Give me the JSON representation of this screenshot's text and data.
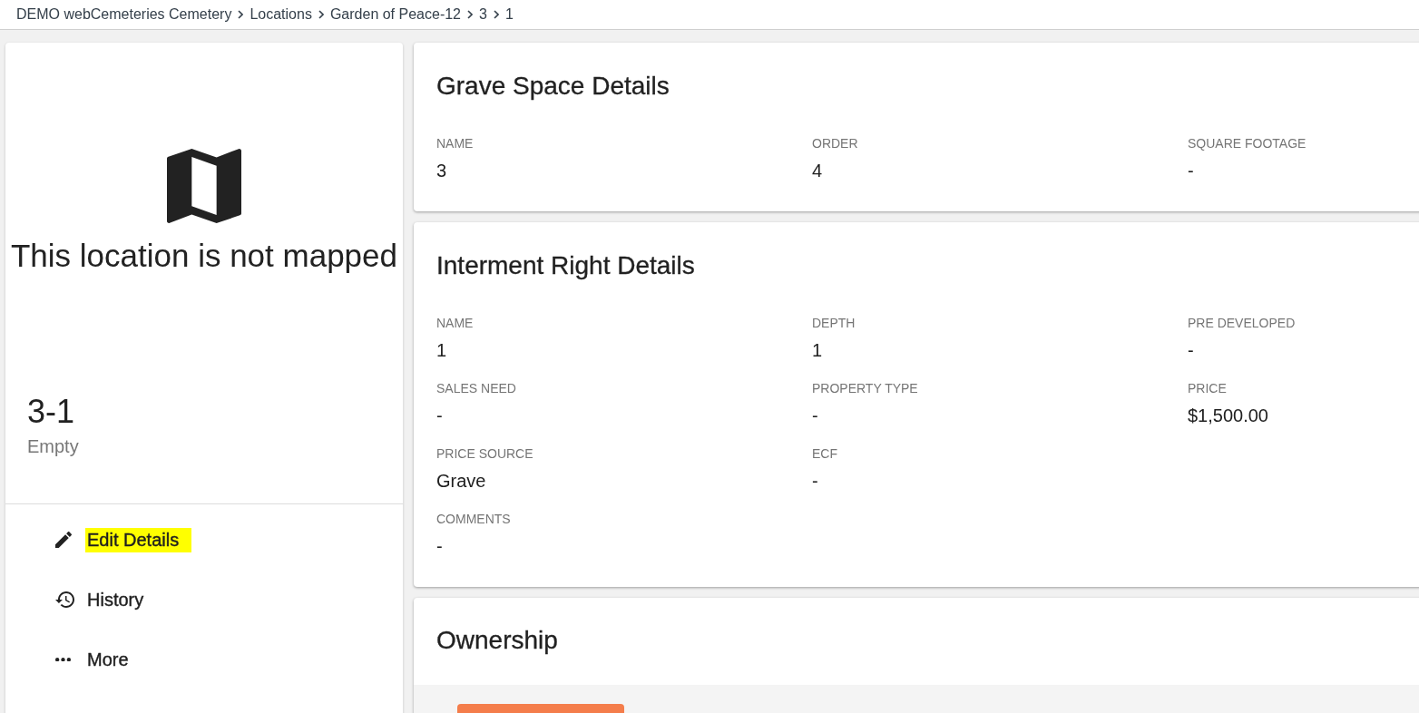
{
  "breadcrumb": {
    "items": [
      "DEMO webCemeteries Cemetery",
      "Locations",
      "Garden of Peace-12",
      "3",
      "1"
    ]
  },
  "left_panel": {
    "map_placeholder": {
      "message": "This location is not mapped"
    },
    "location": {
      "name": "3-1",
      "status": "Empty"
    },
    "actions": [
      {
        "kind": "edit",
        "label": "Edit Details",
        "highlighted": true
      },
      {
        "kind": "history",
        "label": "History",
        "highlighted": false
      },
      {
        "kind": "more",
        "label": "More",
        "highlighted": false
      }
    ]
  },
  "detail_cards": [
    {
      "title": "Grave Space Details",
      "fields": [
        {
          "kind": "field",
          "label": "NAME",
          "value": "3"
        },
        {
          "kind": "field",
          "label": "ORDER",
          "value": "4"
        },
        {
          "kind": "field",
          "label": "SQUARE FOOTAGE",
          "value": "-"
        }
      ]
    },
    {
      "title": "Interment Right Details",
      "fields": [
        {
          "kind": "field",
          "label": "NAME",
          "value": "1"
        },
        {
          "kind": "field",
          "label": "DEPTH",
          "value": "1"
        },
        {
          "kind": "field",
          "label": "PRE DEVELOPED",
          "value": "-"
        },
        {
          "kind": "field",
          "label": "SALES NEED",
          "value": "-"
        },
        {
          "kind": "field",
          "label": "PROPERTY TYPE",
          "value": "-"
        },
        {
          "kind": "field",
          "label": "PRICE",
          "value": "$1,500.00"
        },
        {
          "kind": "field",
          "label": "PRICE SOURCE",
          "value": "Grave"
        },
        {
          "kind": "field",
          "label": "ECF",
          "value": "-"
        },
        {
          "kind": "note",
          "label": "COMMENTS",
          "value": "-"
        }
      ]
    }
  ],
  "ownership": {
    "title": "Ownership"
  }
}
